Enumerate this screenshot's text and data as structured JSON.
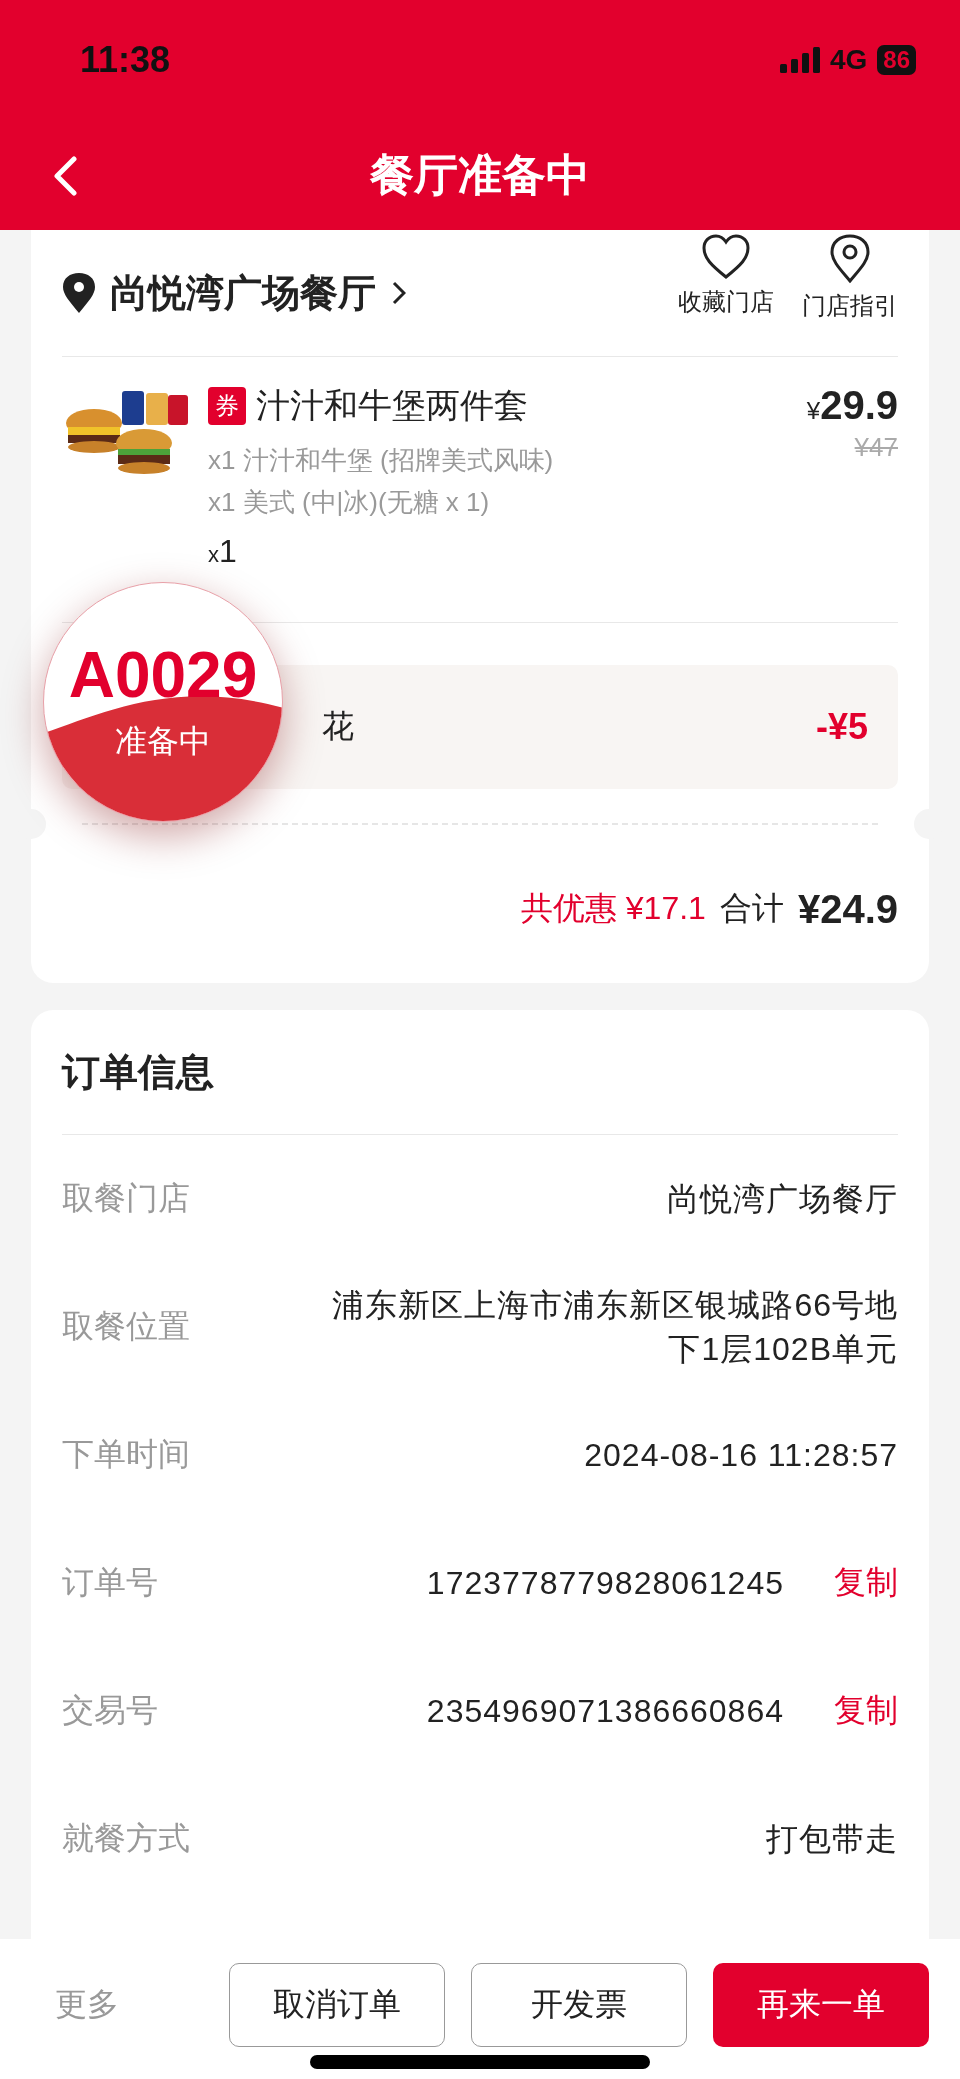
{
  "status_bar": {
    "time": "11:38",
    "network": "4G",
    "battery": "86"
  },
  "header": {
    "title": "餐厅准备中"
  },
  "store": {
    "name": "尚悦湾广场餐厅",
    "actions": [
      {
        "label": "收藏门店",
        "kind": "heart"
      },
      {
        "label": "门店指引",
        "kind": "pin"
      }
    ]
  },
  "product": {
    "badge": "券",
    "name": "汁汁和牛堡两件套",
    "options": [
      "x1 汁汁和牛堡 (招牌美式风味)",
      "x1 美式 (中|冰)(无糖 x 1)"
    ],
    "quantity_prefix": "x",
    "quantity": "1",
    "currency": "¥",
    "price": "29.9",
    "original_price": "¥47"
  },
  "discount": {
    "label": "花",
    "amount": "-¥5"
  },
  "pickup_badge": {
    "number": "A0029",
    "status": "准备中"
  },
  "totals": {
    "saved_label": "共优惠",
    "saved": "¥17.1",
    "total_label": "合计",
    "total": "¥24.9"
  },
  "order_info": {
    "title": "订单信息",
    "rows": [
      {
        "label": "取餐门店",
        "value": "尚悦湾广场餐厅"
      },
      {
        "label": "取餐位置",
        "value": "浦东新区上海市浦东新区银城路66号地下1层102B单元"
      },
      {
        "label": "下单时间",
        "value": "2024-08-16 11:28:57"
      },
      {
        "label": "订单号",
        "value": "1723778779828061245",
        "action": "复制"
      },
      {
        "label": "交易号",
        "value": "2354969071386660864",
        "action": "复制"
      },
      {
        "label": "就餐方式",
        "value": "打包带走"
      }
    ]
  },
  "bottom_bar": {
    "more": "更多",
    "buttons": [
      {
        "label": "取消订单",
        "kind": "outline"
      },
      {
        "label": "开发票",
        "kind": "outline"
      },
      {
        "label": "再来一单",
        "kind": "primary"
      }
    ]
  }
}
